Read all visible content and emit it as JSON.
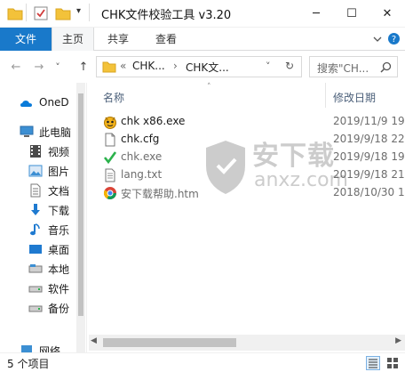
{
  "window": {
    "title": "CHK文件校验工具 v3.20",
    "controls": {
      "minimize": "─",
      "maximize": "☐",
      "close": "✕"
    }
  },
  "ribbon": {
    "tabs": [
      {
        "label": "文件",
        "active": false
      },
      {
        "label": "主页",
        "active": true
      },
      {
        "label": "共享",
        "active": false
      },
      {
        "label": "查看",
        "active": false
      }
    ],
    "expand_icon": "chevron-down-icon",
    "help_icon": "help-icon"
  },
  "address": {
    "back": "←",
    "forward": "→",
    "recent": "˅",
    "up": "↑",
    "prefix": "«",
    "segments": [
      "CHK...",
      "CHK文..."
    ],
    "separator": "›",
    "dropdown": "˅",
    "refresh": "↻",
    "search_placeholder": "搜索\"CH..."
  },
  "nav": {
    "items": [
      {
        "label": "OneD",
        "icon": "onedrive-icon",
        "color": "#0a7bd9"
      },
      {
        "label": "此电脑",
        "icon": "computer-icon",
        "color": "#3c8fd3"
      },
      {
        "label": "视频",
        "icon": "video-icon",
        "color": "#4a4a4a"
      },
      {
        "label": "图片",
        "icon": "pictures-icon",
        "color": "#3c8fd3"
      },
      {
        "label": "文档",
        "icon": "documents-icon",
        "color": "#7a7a7a"
      },
      {
        "label": "下载",
        "icon": "download-icon",
        "color": "#1f7ad0"
      },
      {
        "label": "音乐",
        "icon": "music-icon",
        "color": "#1f7ad0"
      },
      {
        "label": "桌面",
        "icon": "desktop-icon",
        "color": "#1f7ad0"
      },
      {
        "label": "本地",
        "icon": "drive-icon",
        "color": "#7a7a7a"
      },
      {
        "label": "软件",
        "icon": "drive-icon",
        "color": "#7a7a7a"
      },
      {
        "label": "备份",
        "icon": "drive-icon",
        "color": "#7a7a7a"
      },
      {
        "label": "网络",
        "icon": "network-icon",
        "color": "#3c8fd3"
      }
    ]
  },
  "columns": {
    "name": "名称",
    "modified": "修改日期"
  },
  "files": [
    {
      "name": "chk x86.exe",
      "date": "2019/11/9 19:",
      "icon": "app-exe-icon",
      "dim": false
    },
    {
      "name": "chk.cfg",
      "date": "2019/9/18 22:",
      "icon": "file-icon",
      "dim": false
    },
    {
      "name": "chk.exe",
      "date": "2019/9/18 19:",
      "icon": "checkmark-icon",
      "dim": true
    },
    {
      "name": "lang.txt",
      "date": "2019/9/18 21:",
      "icon": "text-file-icon",
      "dim": true
    },
    {
      "name": "安下载帮助.htm",
      "date": "2018/10/30 18:",
      "icon": "chrome-html-icon",
      "dim": true
    }
  ],
  "watermark": {
    "cn": "安下载",
    "en": "anxz.com"
  },
  "status": {
    "item_count": "5 个项目"
  },
  "colors": {
    "file_tab": "#1979ca",
    "header_text": "#4c607a",
    "folder": "#f3c23a"
  }
}
